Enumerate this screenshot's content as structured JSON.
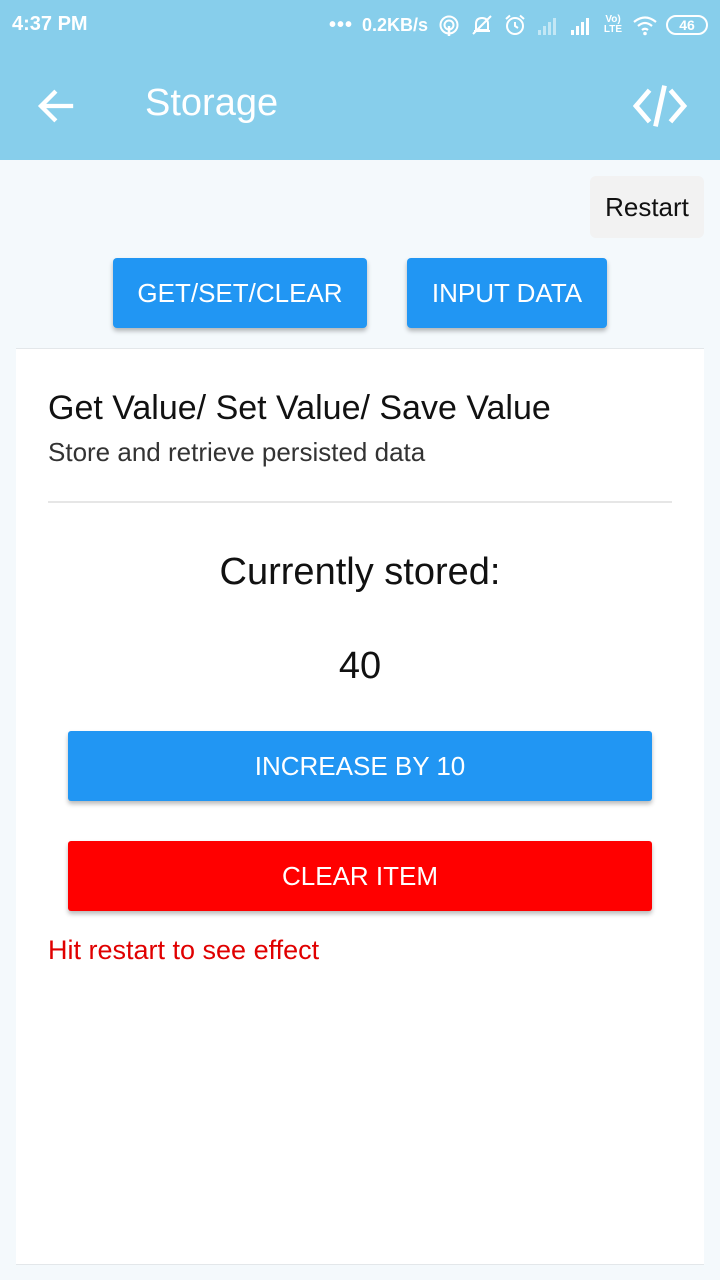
{
  "status_bar": {
    "time": "4:37 PM",
    "dots": "•••",
    "net_speed": "0.2KB/s",
    "volte": "Vo)\nLTE",
    "battery": "46",
    "icons": [
      "hotspot-icon",
      "notifications-off-icon",
      "alarm-icon",
      "signal-weak-icon",
      "signal-icon",
      "volte-icon",
      "wifi-icon",
      "battery-icon"
    ]
  },
  "app_bar": {
    "title": "Storage",
    "back_icon": "arrow-left-icon",
    "code_icon": "code-icon"
  },
  "restart_label": "Restart",
  "tabs": [
    {
      "label": "GET/SET/CLEAR"
    },
    {
      "label": "INPUT DATA"
    }
  ],
  "card": {
    "title": "Get Value/ Set Value/ Save Value",
    "subtitle": "Store and retrieve persisted data",
    "stored_label": "Currently stored:",
    "stored_value": "40",
    "increase_label": "INCREASE BY 10",
    "clear_label": "CLEAR ITEM",
    "hint": "Hit restart to see effect"
  },
  "colors": {
    "app_bar": "#87ceeb",
    "primary_button": "#2196f3",
    "danger_button": "#ff0000",
    "hint_text": "#e00000",
    "background": "#f4f9fc"
  }
}
